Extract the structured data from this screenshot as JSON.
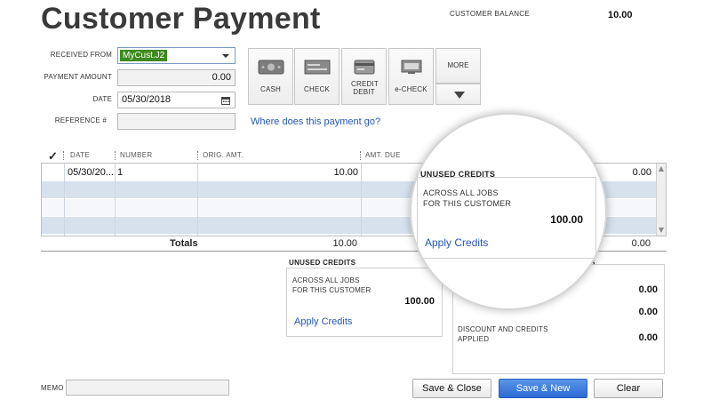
{
  "header": {
    "title": "Customer Payment",
    "customer_balance_label": "CUSTOMER BALANCE",
    "customer_balance_value": "10.00"
  },
  "form": {
    "received_from_label": "RECEIVED FROM",
    "received_from_value": "MyCust.J2",
    "payment_amount_label": "PAYMENT AMOUNT",
    "payment_amount_value": "0.00",
    "date_label": "DATE",
    "date_value": "05/30/2018",
    "reference_label": "REFERENCE #",
    "reference_value": ""
  },
  "payment_methods": [
    {
      "label": "CASH",
      "icon": "cash-icon"
    },
    {
      "label": "CHECK",
      "icon": "check-icon"
    },
    {
      "label": "CREDIT DEBIT",
      "icon": "credit-card-icon"
    },
    {
      "label": "e-CHECK",
      "icon": "echeck-icon"
    }
  ],
  "more_label": "MORE",
  "where_link": "Where does this payment go?",
  "table": {
    "columns": [
      "DATE",
      "NUMBER",
      "ORIG. AMT.",
      "AMT. DUE"
    ],
    "rows": [
      {
        "date": "05/30/20...",
        "number": "1",
        "orig_amt": "10.00",
        "payment": "0.00"
      }
    ],
    "totals_label": "Totals",
    "totals_orig": "10.00",
    "totals_payment": "0.00"
  },
  "unused_credits": {
    "title": "UNUSED CREDITS",
    "desc_line1": "ACROSS ALL JOBS",
    "desc_line2": "FOR THIS CUSTOMER",
    "amount": "100.00",
    "link": "Apply Credits"
  },
  "summary": {
    "title_fragment": "S",
    "value1": "0.00",
    "value2": "0.00",
    "discount_line1": "DISCOUNT AND CREDITS",
    "discount_line2": "APPLIED",
    "discount_value": "0.00"
  },
  "memo_label": "MEMO",
  "buttons": {
    "save_close": "Save & Close",
    "save_new": "Save & New",
    "clear": "Clear"
  },
  "colors": {
    "accent": "#2c6ad3",
    "link": "#2456b8",
    "row_alt": "#d7e1ee",
    "customer_chip": "#3d8a1e"
  }
}
